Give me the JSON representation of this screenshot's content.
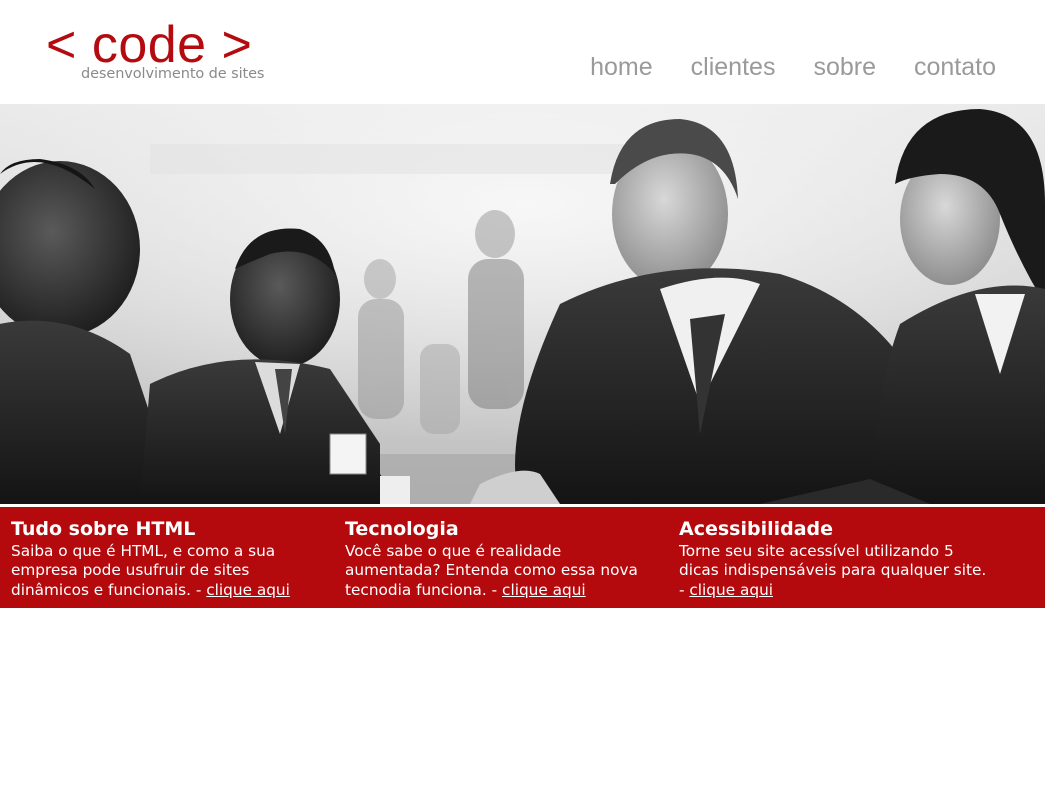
{
  "brand": {
    "logo": "< code >",
    "tagline": "desenvolvimento de sites",
    "accent_color": "#b50a0d"
  },
  "nav": {
    "items": [
      "home",
      "clientes",
      "sobre",
      "contato"
    ]
  },
  "hero": {
    "image_subject": "business-handshake-photo"
  },
  "features": [
    {
      "title": "Tudo sobre HTML",
      "text": "Saiba o que é HTML, e como a sua empresa pode usufruir de sites dinâmicos e funcionais. - ",
      "link": "clique aqui"
    },
    {
      "title": "Tecnologia",
      "text": "Você sabe o que é realidade aumentada? Entenda como essa nova tecnodia funciona. - ",
      "link": "clique aqui"
    },
    {
      "title": "Acessibilidade",
      "text": "Torne seu site acessível utilizando 5 dicas indispensáveis para qualquer site. - ",
      "link": "clique aqui"
    }
  ]
}
